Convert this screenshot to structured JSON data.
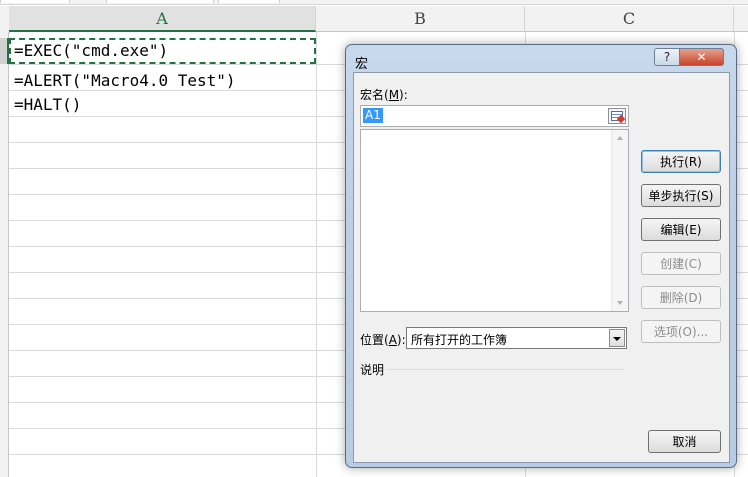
{
  "sheet": {
    "columns": [
      "A",
      "B",
      "C"
    ],
    "cells": [
      "=EXEC(\"cmd.exe\")",
      "=ALERT(\"Macro4.0 Test\")",
      "=HALT()"
    ]
  },
  "dialog": {
    "title": "宏",
    "help_glyph": "?",
    "close_glyph": "✕",
    "macro_name_label": "宏名(",
    "macro_name_accel": "M",
    "macro_name_label_end": "):",
    "macro_name_value": "A1",
    "buttons": {
      "run": "执行(R)",
      "step_into": "单步执行(S)",
      "edit": "编辑(E)",
      "create": "创建(C)",
      "delete": "删除(D)",
      "options": "选项(O)...",
      "cancel": "取消"
    },
    "location_label": "位置(",
    "location_accel": "A",
    "location_label_end": "):",
    "location_value": "所有打开的工作簿",
    "description_label": "说明"
  },
  "colors": {
    "accent": "#217346",
    "dialog_frame": "#c8d8ec",
    "selection": "#3399ff"
  }
}
